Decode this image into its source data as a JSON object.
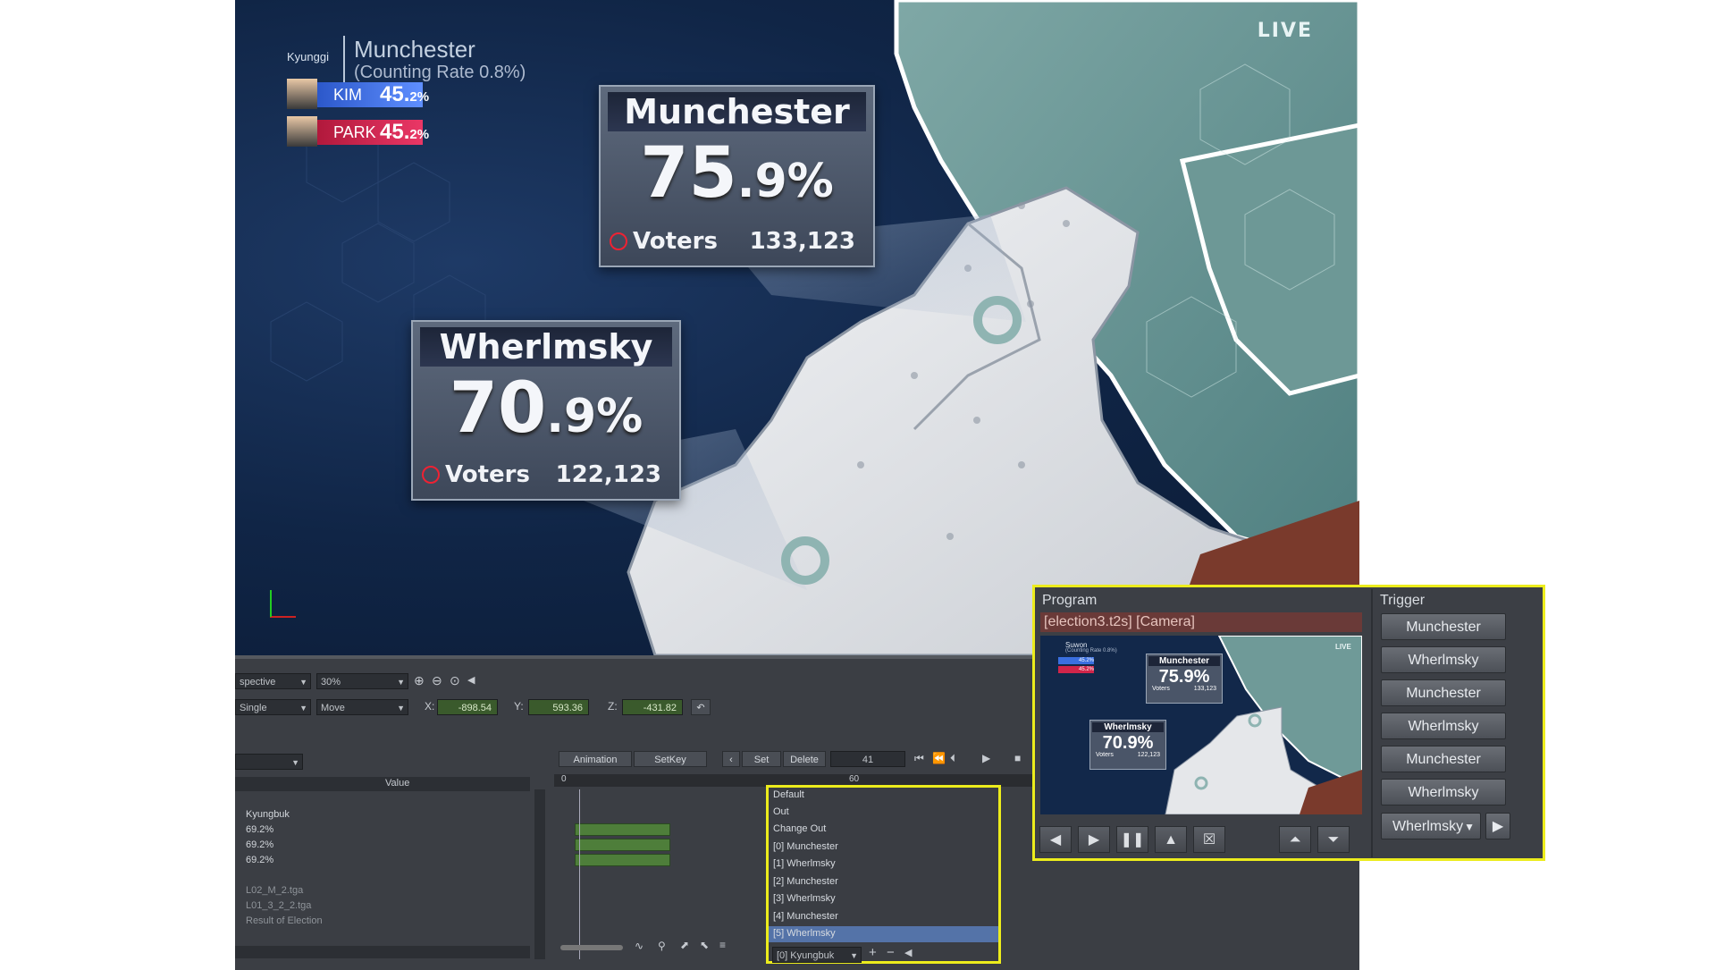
{
  "viewport": {
    "live_label": "LIVE",
    "region_label": "Kyunggi",
    "city": "Munchester",
    "counting_rate": "(Counting Rate 0.8%)",
    "candidates": [
      {
        "name": "KIM",
        "pct_main": "45.",
        "pct_small": "2%",
        "color": "#3a6fe0"
      },
      {
        "name": "PARK",
        "pct_main": "45.",
        "pct_small": "2%",
        "color": "#d0254a"
      }
    ],
    "results": [
      {
        "title": "Munchester",
        "pct_main": "75",
        "pct_small": ".9%",
        "voters_label": "Voters",
        "voters": "133,123"
      },
      {
        "title": "Wherlmsky",
        "pct_main": "70",
        "pct_small": ".9%",
        "voters_label": "Voters",
        "voters": "122,123"
      }
    ]
  },
  "editor": {
    "view_mode": "spective",
    "zoom": "30%",
    "select_mode": "Single",
    "transform_mode": "Move",
    "coords": {
      "x_label": "X:",
      "x": "-898.54",
      "y_label": "Y:",
      "y": "593.36",
      "z_label": "Z:",
      "z": "-431.82"
    },
    "value_header": "Value",
    "buttons": {
      "animation": "Animation",
      "setkey": "SetKey",
      "set": "Set",
      "delete": "Delete"
    },
    "frame": "41",
    "ruler": {
      "start": "0",
      "mark": "60"
    },
    "values": [
      "Kyungbuk",
      "69.2%",
      "69.2%",
      "69.2%"
    ],
    "assets": [
      "L02_M_2.tga",
      "L01_3_2_2.tga",
      "Result of Election"
    ],
    "events": [
      "Default",
      "Out",
      "Change Out",
      "[0] Munchester",
      "[1] Wherlmsky",
      "[2] Munchester",
      "[3] Wherlmsky",
      "[4] Munchester",
      "[5] Wherlmsky"
    ],
    "selected_event_index": 8,
    "event_select": "[0] Kyungbuk"
  },
  "program": {
    "title": "Program",
    "scene": "[election3.t2s] [Camera]",
    "thumb": {
      "region": "Suwon",
      "rate": "(Counting Rate 0.8%)",
      "live": "LIVE",
      "r1_title": "Munchester",
      "r1_pct": "75.9%",
      "r1_voters_label": "Voters",
      "r1_voters": "133,123",
      "r2_title": "Wherlmsky",
      "r2_pct": "70.9%",
      "r2_voters_label": "Voters",
      "r2_voters": "122,123",
      "c1_pct": "45.2%",
      "c2_pct": "45.2%"
    }
  },
  "trigger": {
    "title": "Trigger",
    "buttons": [
      "Munchester",
      "Wherlmsky",
      "Munchester",
      "Wherlmsky",
      "Munchester",
      "Wherlmsky"
    ],
    "select_value": "Wherlmsky"
  }
}
